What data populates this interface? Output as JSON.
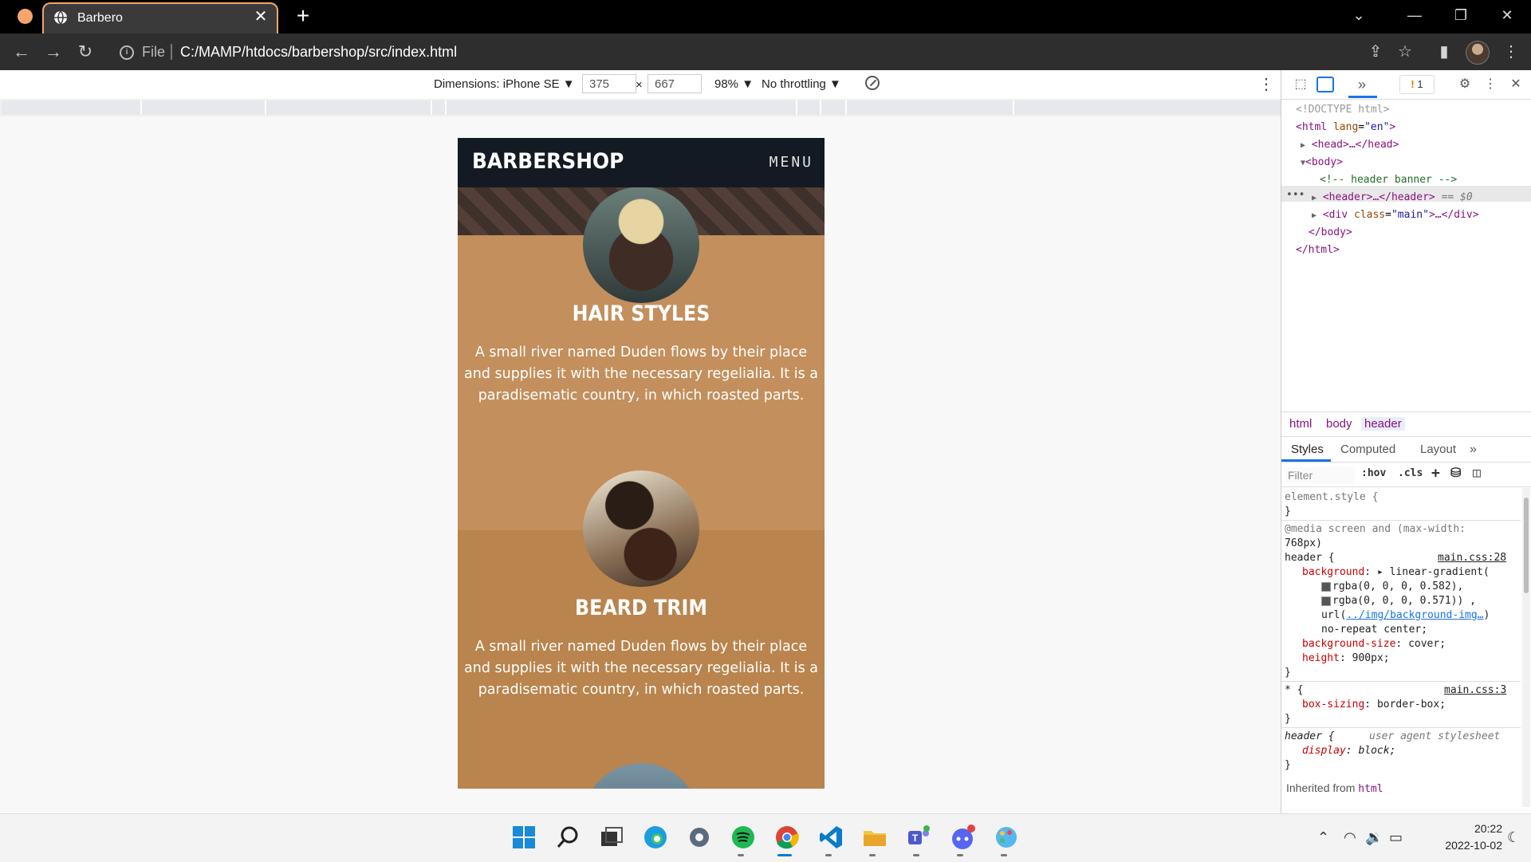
{
  "browser": {
    "tab_title": "Barbero",
    "new_tab_label": "+",
    "close_tab_glyph": "✕",
    "address_prefix": "File",
    "url": "C:/MAMP/htdocs/barbershop/src/index.html",
    "window_controls": [
      "⌄",
      "—",
      "❐",
      "✕"
    ]
  },
  "device_toolbar": {
    "dimensions_label": "Dimensions: iPhone SE ▼",
    "width": "375",
    "times": "×",
    "height": "667",
    "zoom": "98% ▼",
    "throttling": "No throttling ▼"
  },
  "site": {
    "brand": "BARBERSHOP",
    "menu": "MENU",
    "services": [
      {
        "title": "HAIR STYLES",
        "description": "A small river named Duden flows by their place and supplies it with the necessary regelialia. It is a paradisematic country, in which roasted parts."
      },
      {
        "title": "BEARD TRIM",
        "description": "A small river named Duden flows by their place and supplies it with the necessary regelialia. It is a paradisematic country, in which roasted parts."
      }
    ]
  },
  "devtools": {
    "warning_count": "1",
    "dom": {
      "doctype": "<!DOCTYPE html>",
      "html_open_tag": "<html",
      "html_attr": "lang",
      "html_attr_val": "\"en\"",
      "head": "<head>…</head>",
      "body_open": "<body>",
      "comment": "<!-- header banner -->",
      "header": "<header>…</header>",
      "header_suffix": "== $0",
      "div_open": "<div",
      "div_attr": "class",
      "div_attr_val": "\"main\"",
      "div_close": ">…</div>",
      "body_close": "</body>",
      "html_close": "</html>",
      "ellipsis": "•••"
    },
    "breadcrumbs": [
      "html",
      "body",
      "header"
    ],
    "tabs": [
      "Styles",
      "Computed",
      "Layout"
    ],
    "more_tabs": "»",
    "filter_placeholder": "Filter",
    "hov": ":hov",
    "cls": ".cls",
    "styles": {
      "element_style": "element.style {",
      "close_brace": "}",
      "media_line1": "@media screen and (max-width:",
      "media_line2": "768px)",
      "header_selector": "header {",
      "header_source": "main.css:28",
      "bg_prop": "background",
      "bg_val": "▸ linear-gradient(",
      "rgba1": "rgba(0, 0, 0, 0.582),",
      "rgba2": "rgba(0, 0, 0, 0.571)) ,",
      "url_prefix": "url(",
      "url_link": "../img/background-img…",
      "url_suffix": ")",
      "no_repeat": "no-repeat center;",
      "bg_size_prop": "background-size",
      "bg_size_val": "cover;",
      "height_prop": "height",
      "height_val": "900px;",
      "star_selector": "* {",
      "star_source": "main.css:3",
      "box_sizing_prop": "box-sizing",
      "box_sizing_val": "border-box;",
      "ua_selector": "header {",
      "ua_source": "user agent stylesheet",
      "display_prop": "display",
      "display_val": "block;",
      "inherited": "Inherited from",
      "inherited_tag": "html"
    }
  },
  "taskbar": {
    "time": "20:22",
    "date": "2022-10-02"
  }
}
